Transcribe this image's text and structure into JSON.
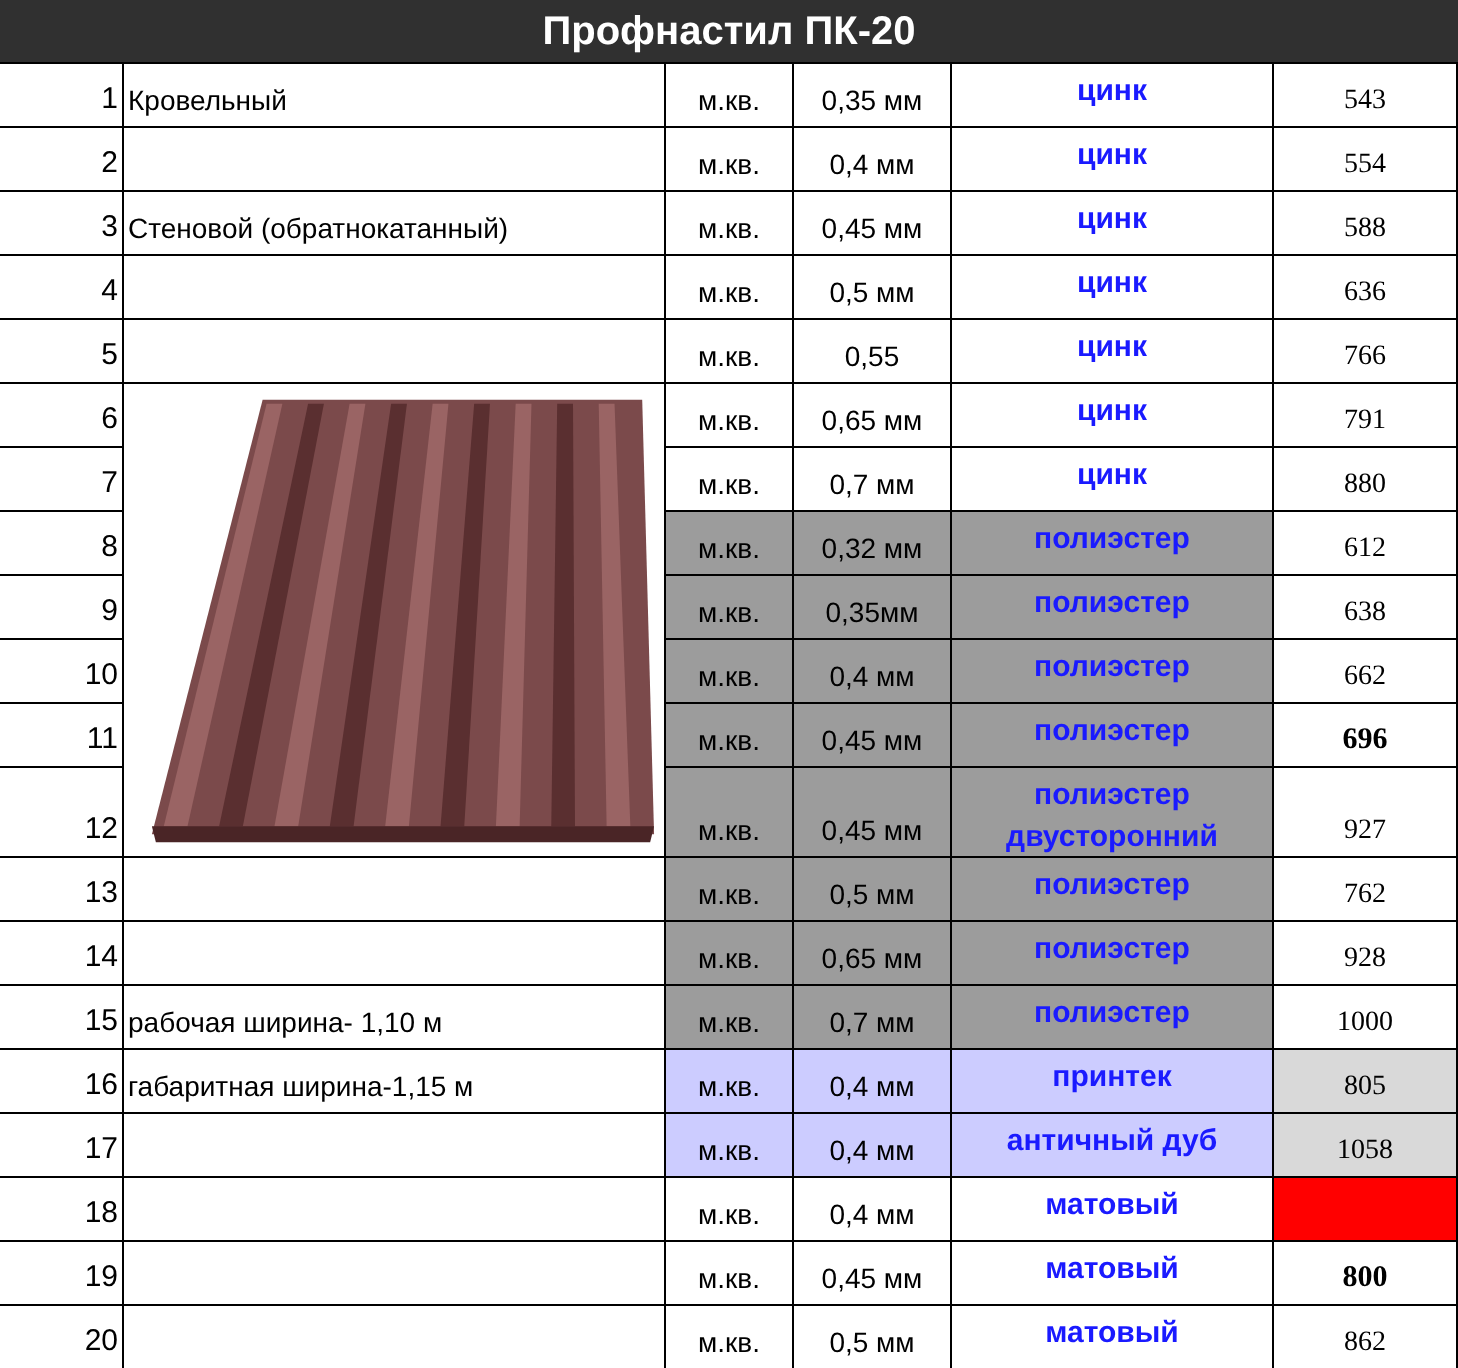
{
  "title": "Профнастил ПК-20",
  "rows": [
    {
      "n": "1",
      "description": "Кровельный",
      "unit": "м.кв.",
      "thickness": "0,35 мм",
      "coating": "цинк",
      "price": {
        "text": "543"
      },
      "color": "#ffffff"
    },
    {
      "n": "2",
      "unit": "м.кв.",
      "thickness": "0,4 мм",
      "coating": "цинк",
      "price": {
        "text": "554"
      },
      "color": "#ffffff"
    },
    {
      "n": "3",
      "description": "Стеновой (обратнокатанный)",
      "unit": "м.кв.",
      "thickness": "0,45 мм",
      "coating": "цинк",
      "price": {
        "text": "588"
      },
      "color": "#ffffff"
    },
    {
      "n": "4",
      "unit": "м.кв.",
      "thickness": "0,5 мм",
      "coating": "цинк",
      "price": {
        "text": "636"
      },
      "color": "#ffffff"
    },
    {
      "n": "5",
      "unit": "м.кв.",
      "thickness": "0,55",
      "coating": "цинк",
      "price": {
        "text": "766"
      },
      "color": "#ffffff"
    },
    {
      "n": "6",
      "unit": "м.кв.",
      "thickness": "0,65 мм",
      "coating": "цинк",
      "price": {
        "text": "791"
      },
      "color": "#ffffff"
    },
    {
      "n": "7",
      "unit": "м.кв.",
      "thickness": "0,7 мм",
      "coating": "цинк",
      "price": {
        "text": "880"
      },
      "color": "#ffffff"
    },
    {
      "n": "8",
      "unit": "м.кв.",
      "thickness": "0,32 мм",
      "coating": "полиэстер",
      "price": {
        "text": "612"
      },
      "color": "#9c9c9c"
    },
    {
      "n": "9",
      "unit": "м.кв.",
      "thickness": "0,35мм",
      "coating": "полиэстер",
      "price": {
        "text": "638"
      },
      "color": "#9c9c9c"
    },
    {
      "n": "10",
      "unit": "м.кв.",
      "thickness": "0,4 мм",
      "coating": "полиэстер",
      "price": {
        "text": "662"
      },
      "color": "#9c9c9c"
    },
    {
      "n": "11",
      "unit": "м.кв.",
      "thickness": "0,45 мм",
      "coating": "полиэстер",
      "price": {
        "text": "696"
      },
      "bold": true,
      "color": "#9c9c9c"
    },
    {
      "n": "12",
      "unit": "м.кв.",
      "thickness": "0,45 мм",
      "coating": "полиэстер двусторонний",
      "price": {
        "text": "927"
      },
      "color": "#9c9c9c"
    },
    {
      "n": "13",
      "unit": "м.кв.",
      "thickness": "0,5 мм",
      "coating": "полиэстер",
      "price": {
        "text": "762"
      },
      "color": "#9c9c9c"
    },
    {
      "n": "14",
      "unit": "м.кв.",
      "thickness": "0,65 мм",
      "coating": "полиэстер",
      "price": {
        "text": "928"
      },
      "color": "#9c9c9c"
    },
    {
      "n": "15",
      "description": "рабочая ширина- 1,10 м",
      "unit": "м.кв.",
      "thickness": "0,7 мм",
      "coating": "полиэстер",
      "price": {
        "text": "1000"
      },
      "color": "#9c9c9c"
    },
    {
      "n": "16",
      "description": "габаритная ширина-1,15 м",
      "unit": "м.кв.",
      "thickness": "0,4 мм",
      "coating": "принтек",
      "price": {
        "text": "805",
        "color": "#d9d9d9"
      },
      "color": "#ccccff"
    },
    {
      "n": "17",
      "unit": "м.кв.",
      "thickness": "0,4 мм",
      "coating": "античный дуб",
      "price": {
        "text": "1058",
        "color": "#d9d9d9"
      },
      "color": "#ccccff"
    },
    {
      "n": "18",
      "unit": "м.кв.",
      "thickness": "0,4 мм",
      "coating": "матовый",
      "price": {
        "color": "#ff0000"
      },
      "color": "#ffffff"
    },
    {
      "n": "19",
      "unit": "м.кв.",
      "thickness": "0,45 мм",
      "coating": "матовый",
      "price": {
        "text": "800"
      },
      "bold": true,
      "color": "#ffffff"
    },
    {
      "n": "20",
      "unit": "м.кв.",
      "thickness": "0,5 мм",
      "coating": "матовый",
      "price": {
        "text": "862"
      },
      "color": "#ffffff"
    }
  ]
}
